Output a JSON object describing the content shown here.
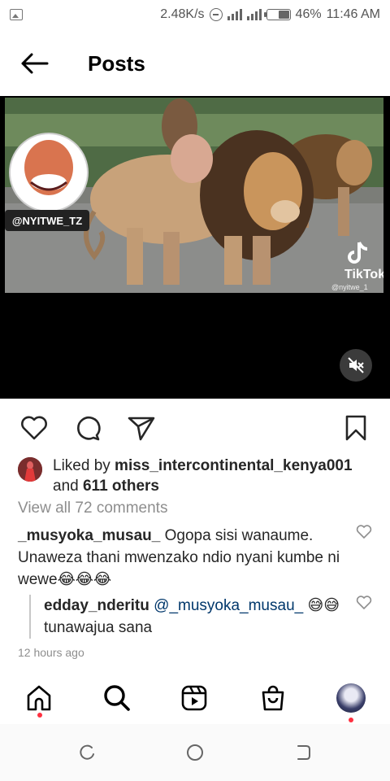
{
  "status_bar": {
    "net_speed": "2.48K/s",
    "battery": "46%",
    "time": "11:46 AM",
    "icons": [
      "gallery-icon",
      "dnd-icon",
      "signal-icon",
      "signal-icon",
      "battery-icon"
    ]
  },
  "header": {
    "title": "Posts",
    "back_icon": "arrow-left-icon"
  },
  "media": {
    "watermark_handle": "@NYITWE_TZ",
    "tiktok_label": "TikTok",
    "tiktok_sub": "@nyitwe_1",
    "mute_icon": "volume-muted-icon"
  },
  "actions": {
    "like_icon": "heart-icon",
    "comment_icon": "comment-icon",
    "share_icon": "send-icon",
    "save_icon": "bookmark-icon"
  },
  "likes": {
    "prefix": "Liked by ",
    "user": "miss_intercontinental_kenya001",
    "and": "and ",
    "count": "611 others"
  },
  "view_all_comments": "View all 72 comments",
  "comment": {
    "user": "_musyoka_musau_",
    "text": " Ogopa sisi wanaume. Unaweza thani mwenzako ndio nyani kumbe ni wewe😂😂😂"
  },
  "reply": {
    "user": "edday_nderitu",
    "mention": "@_musyoka_musau_",
    "text": " 😅😅tunawajua sana"
  },
  "timestamp": "12 hours ago",
  "bottom_nav": {
    "items": [
      "home-icon",
      "search-icon",
      "reels-icon",
      "shop-icon",
      "profile-avatar"
    ]
  },
  "colors": {
    "text": "#262626",
    "muted": "#8e8e8e",
    "mention": "#00376b",
    "notification_dot": "#ff3040"
  }
}
